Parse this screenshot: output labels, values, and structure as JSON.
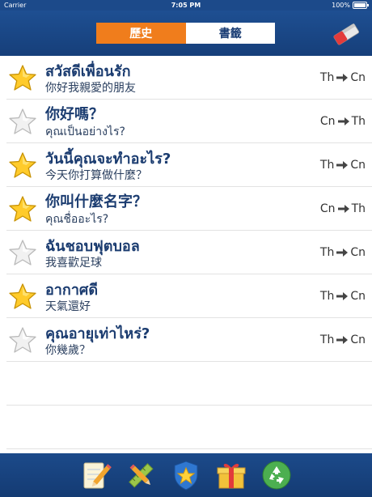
{
  "status": {
    "carrier": "Carrier",
    "time": "7:05 PM",
    "battery": "100%"
  },
  "tabs": {
    "history": "歷史",
    "bookmarks": "書籤"
  },
  "rows": [
    {
      "primary": "สวัสดีเพื่อนรัก",
      "secondary": "你好我親愛的朋友",
      "from": "Th",
      "to": "Cn",
      "starred": true
    },
    {
      "primary": "你好嗎？",
      "secondary": "คุณเป็นอย่างไร?",
      "from": "Cn",
      "to": "Th",
      "starred": false
    },
    {
      "primary": "วันนี้คุณจะทำอะไร?",
      "secondary": "今天你打算做什麼？",
      "from": "Th",
      "to": "Cn",
      "starred": true
    },
    {
      "primary": "你叫什麼名字？",
      "secondary": "คุณชื่ออะไร?",
      "from": "Cn",
      "to": "Th",
      "starred": true
    },
    {
      "primary": "ฉันชอบฟุตบอล",
      "secondary": "我喜歡足球",
      "from": "Th",
      "to": "Cn",
      "starred": false
    },
    {
      "primary": "อากาศดี",
      "secondary": "天氣還好",
      "from": "Th",
      "to": "Cn",
      "starred": true
    },
    {
      "primary": "คุณอายุเท่าไหร่?",
      "secondary": "你幾歲？",
      "from": "Th",
      "to": "Cn",
      "starred": false
    }
  ],
  "toolbar_icons": [
    "notepad-pencil-icon",
    "pencil-ruler-icon",
    "star-shield-icon",
    "gift-box-icon",
    "recycle-icon"
  ],
  "colors": {
    "header": "#1e4f92",
    "accent": "#f07d1c",
    "text": "#1b3c70"
  }
}
